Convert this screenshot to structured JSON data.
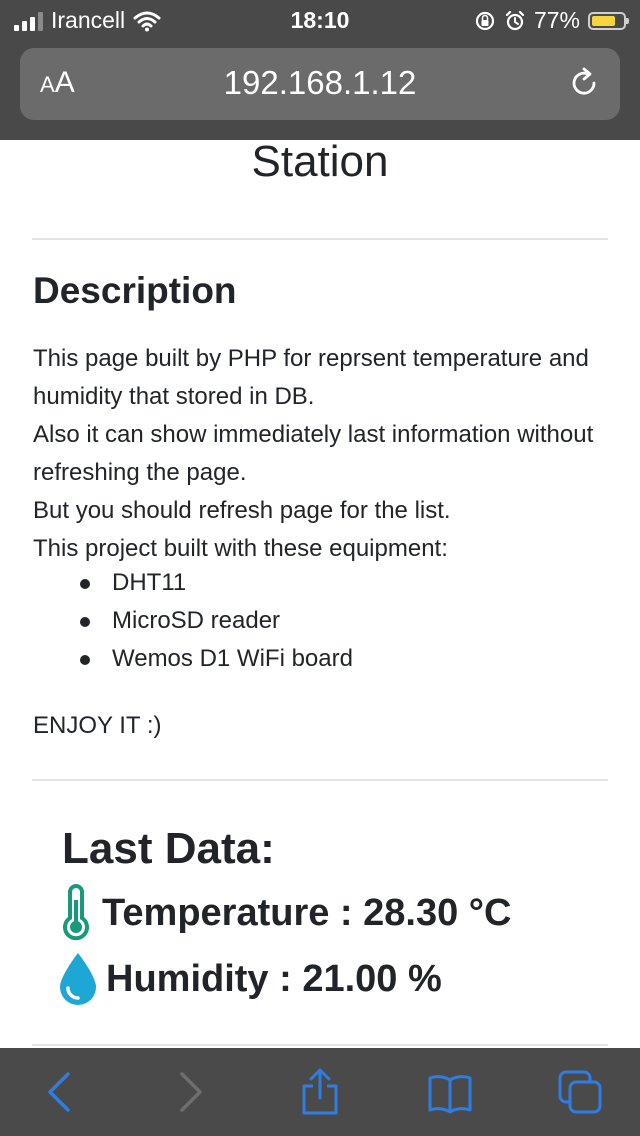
{
  "status_bar": {
    "carrier": "Irancell",
    "time": "18:10",
    "battery_percent": "77%",
    "battery_level": 0.77,
    "battery_color": "#f7d53c"
  },
  "browser": {
    "text_size_label_small": "A",
    "text_size_label_large": "A",
    "url": "192.168.1.12",
    "reload_icon": "reload-icon"
  },
  "page": {
    "title": "Station",
    "description": {
      "heading": "Description",
      "paragraphs": [
        "This page built by PHP for reprsent temperature and humidity that stored in DB.",
        "Also it can show immediately last information without refreshing the page.",
        "But you should refresh page for the list.",
        "This project built with these equipment:"
      ],
      "equipment": [
        "DHT11",
        "MicroSD reader",
        "Wemos D1 WiFi board"
      ],
      "closing": "ENJOY IT :)"
    },
    "last_data": {
      "heading": "Last Data:",
      "temperature": "Temperature : 28.30 °C",
      "humidity": "Humidity : 21.00 %",
      "temperature_icon": "thermometer-icon",
      "humidity_icon": "water-drop-icon",
      "temperature_icon_color": "#17997a",
      "humidity_icon_color": "#1ea7d4"
    }
  },
  "toolbar": {
    "icons": [
      "back-icon",
      "forward-icon",
      "share-icon",
      "bookmarks-icon",
      "tabs-icon"
    ],
    "accent_color": "#2f7de1"
  }
}
